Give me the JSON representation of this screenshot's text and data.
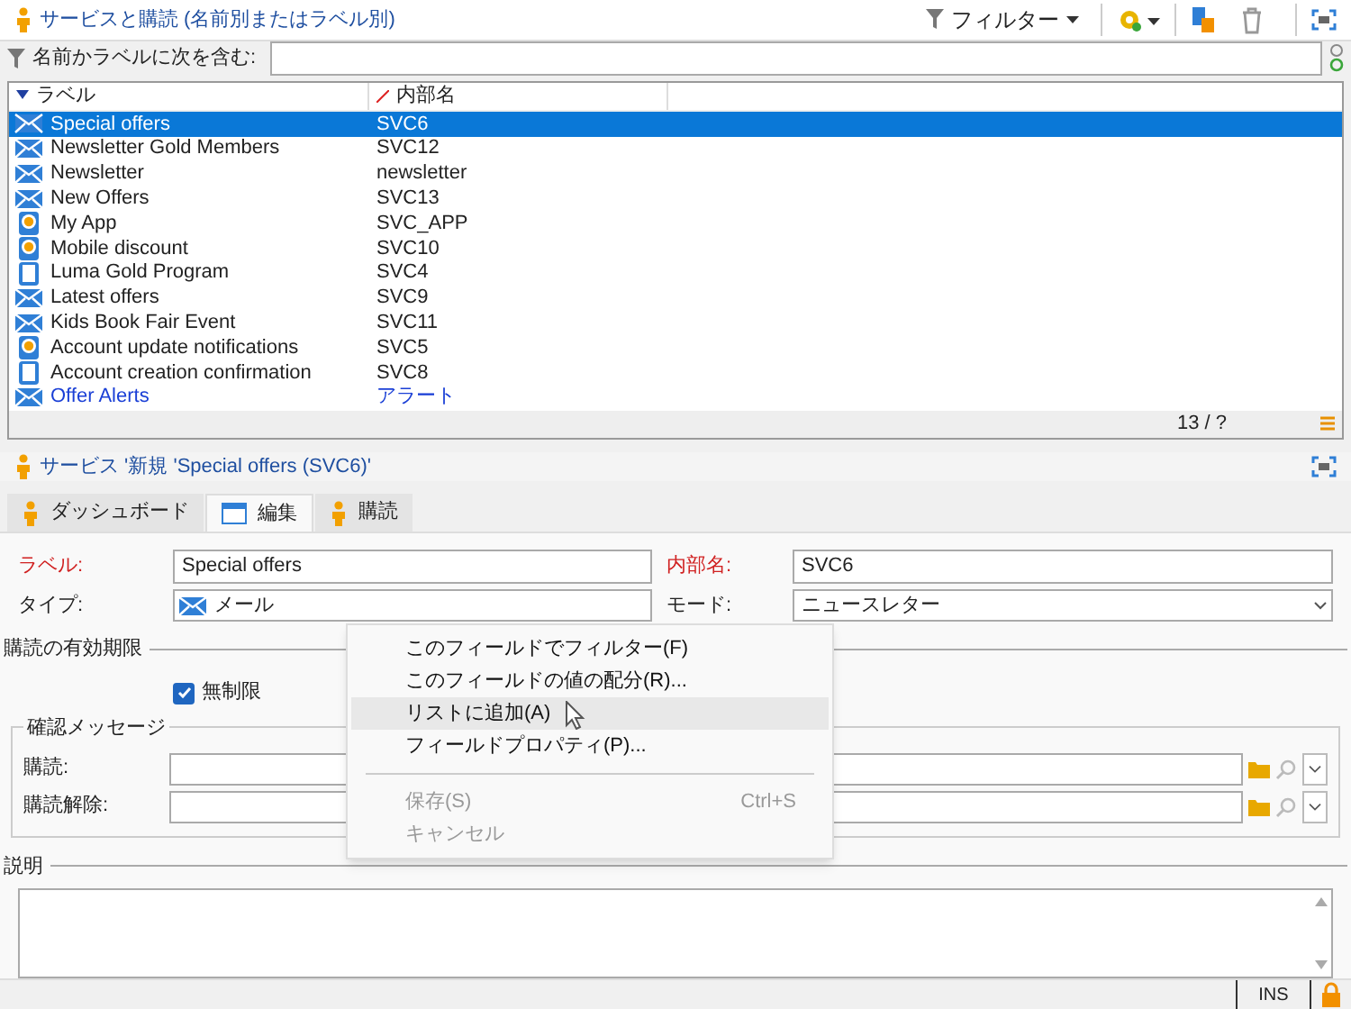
{
  "header": {
    "title": "サービスと購読 (名前別またはラベル別)",
    "filter_button": "フィルター"
  },
  "filter": {
    "label": "名前かラベルに次を含む:"
  },
  "table": {
    "columns": [
      "ラベル",
      "内部名"
    ],
    "rows": [
      {
        "kind": "email",
        "label": "Special offers",
        "name": "SVC6",
        "selected": true,
        "emphasized": false
      },
      {
        "kind": "email",
        "label": "Newsletter Gold Members",
        "name": "SVC12",
        "selected": false,
        "emphasized": false
      },
      {
        "kind": "email",
        "label": "Newsletter",
        "name": "newsletter",
        "selected": false,
        "emphasized": false
      },
      {
        "kind": "email",
        "label": "New Offers",
        "name": "SVC13",
        "selected": false,
        "emphasized": false
      },
      {
        "kind": "app",
        "label": "My App",
        "name": "SVC_APP",
        "selected": false,
        "emphasized": false
      },
      {
        "kind": "app",
        "label": "Mobile discount",
        "name": "SVC10",
        "selected": false,
        "emphasized": false
      },
      {
        "kind": "mobile",
        "label": "Luma Gold Program",
        "name": "SVC4",
        "selected": false,
        "emphasized": false
      },
      {
        "kind": "email",
        "label": "Latest offers",
        "name": "SVC9",
        "selected": false,
        "emphasized": false
      },
      {
        "kind": "email",
        "label": "Kids Book Fair Event",
        "name": "SVC11",
        "selected": false,
        "emphasized": false
      },
      {
        "kind": "app",
        "label": "Account update notifications",
        "name": "SVC5",
        "selected": false,
        "emphasized": false
      },
      {
        "kind": "mobile",
        "label": "Account creation confirmation",
        "name": "SVC8",
        "selected": false,
        "emphasized": false
      },
      {
        "kind": "email",
        "label": "Offer Alerts",
        "name": "アラート",
        "selected": false,
        "emphasized": true
      }
    ],
    "count": "13 / ?"
  },
  "detail": {
    "title": "サービス '新規 'Special offers (SVC6)'",
    "tabs": [
      {
        "kind": "person",
        "label": "ダッシュボード",
        "selected": false
      },
      {
        "kind": "window",
        "label": "編集",
        "selected": true
      },
      {
        "kind": "person",
        "label": "購読",
        "selected": false
      }
    ],
    "label_field": {
      "label": "ラベル:",
      "value": "Special offers"
    },
    "internal_name_field": {
      "label": "内部名:",
      "value": "SVC6"
    },
    "type_field": {
      "label": "タイプ:",
      "value": "メール"
    },
    "mode_field": {
      "label": "モード:",
      "value": "ニュースレター"
    },
    "validity": {
      "title": "購読の有効期限",
      "checkbox": {
        "label": "無制限",
        "checked": true
      }
    },
    "confirmation": {
      "title": "確認メッセージ",
      "fields": [
        {
          "label": "購読:"
        },
        {
          "label": "購読解除:"
        }
      ]
    },
    "description": {
      "title": "説明"
    }
  },
  "context_menu": [
    {
      "label": "このフィールドでフィルター(F)",
      "disabled": false,
      "hovered": false
    },
    {
      "label": "このフィールドの値の配分(R)...",
      "disabled": false,
      "hovered": false
    },
    {
      "label": "リストに追加(A)",
      "disabled": false,
      "hovered": true
    },
    {
      "label": "フィールドプロパティ(P)...",
      "disabled": false,
      "hovered": false
    },
    {
      "kind": "separator"
    },
    {
      "label": "保存(S)",
      "shortcut": "Ctrl+S",
      "disabled": true,
      "hovered": false
    },
    {
      "label": "キャンセル",
      "disabled": true,
      "hovered": false
    }
  ],
  "status_bar": {
    "mode": "INS"
  }
}
